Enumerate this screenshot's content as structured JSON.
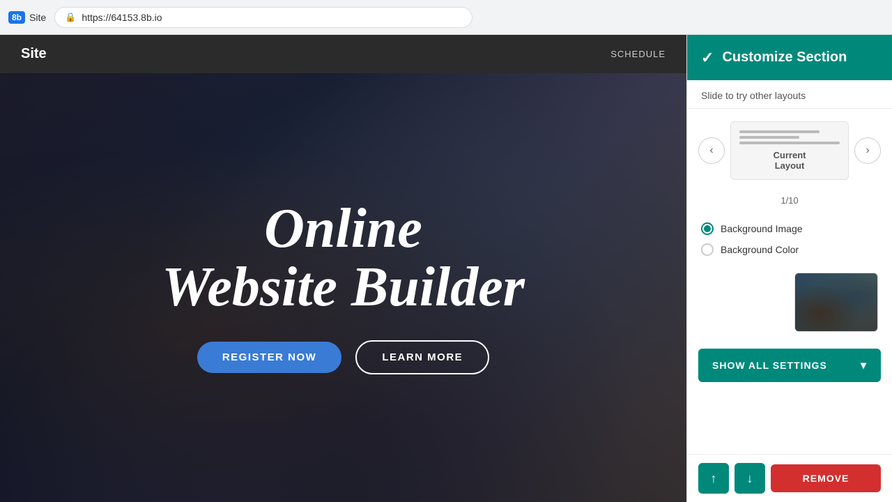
{
  "browser": {
    "logo_text": "8b",
    "tab_title": "Site",
    "address": "https://64153.8b.io",
    "lock_icon": "🔒"
  },
  "site_nav": {
    "title": "Site",
    "links": [
      "SCHEDULE"
    ]
  },
  "hero": {
    "title_line1": "Online",
    "title_line2": "Website Builder",
    "btn_primary": "REGISTER NOW",
    "btn_secondary": "LEARN MORE"
  },
  "panel": {
    "header_title": "Customize Section",
    "check_icon": "✓",
    "subtitle": "Slide to try other layouts",
    "layout_current_label": "Current",
    "layout_current_sub": "Layout",
    "pagination": "1/10",
    "bg_image_label": "Background Image",
    "bg_color_label": "Background Color",
    "show_all_label": "SHOW ALL SETTINGS",
    "remove_label": "REMOVE",
    "move_up_icon": "↑",
    "move_down_icon": "↓",
    "prev_icon": "‹",
    "next_icon": "›"
  }
}
